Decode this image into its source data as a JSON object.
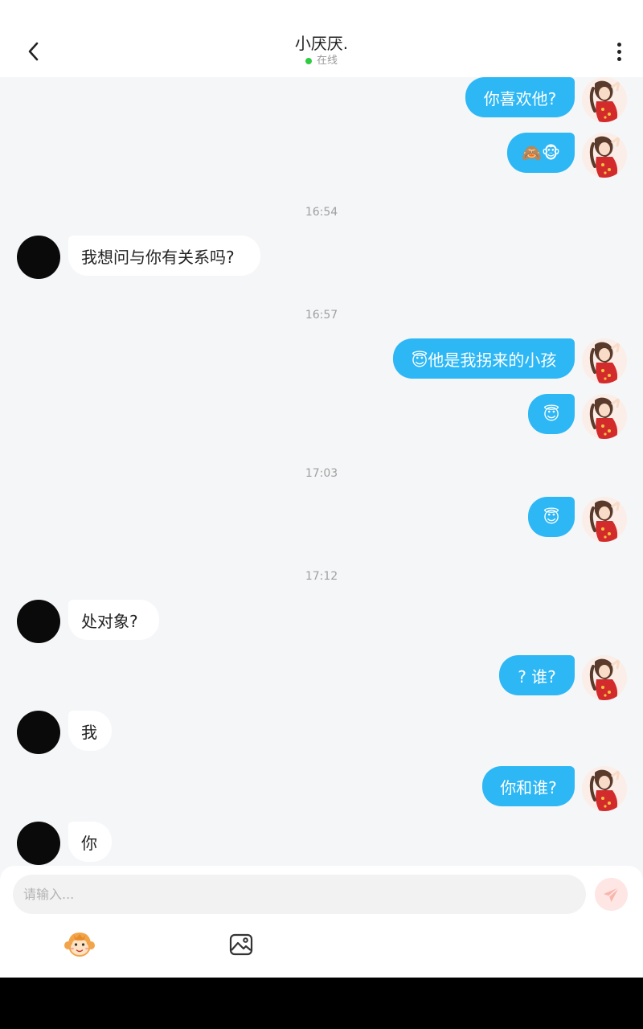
{
  "header": {
    "title": "小厌厌.",
    "status": "在线",
    "status_color": "#2ecc40"
  },
  "messages": [
    {
      "kind": "out",
      "text": "你喜欢他?"
    },
    {
      "kind": "out",
      "text": "🙈🐵"
    },
    {
      "kind": "time",
      "text": "16:54"
    },
    {
      "kind": "in",
      "text": "我想问与你有关系吗?"
    },
    {
      "kind": "time",
      "text": "16:57"
    },
    {
      "kind": "out",
      "text": "😇他是我拐来的小孩"
    },
    {
      "kind": "out",
      "text": "😇"
    },
    {
      "kind": "time",
      "text": "17:03"
    },
    {
      "kind": "out",
      "text": "😇"
    },
    {
      "kind": "time",
      "text": "17:12"
    },
    {
      "kind": "in",
      "text": "处对象?"
    },
    {
      "kind": "out",
      "text": "? 谁?"
    },
    {
      "kind": "in",
      "text": "我"
    },
    {
      "kind": "out",
      "text": "你和谁?"
    },
    {
      "kind": "in",
      "text": "你"
    }
  ],
  "input": {
    "placeholder": "请输入...",
    "value": ""
  },
  "toolbar": {
    "emoji_icon": "monkey-face-icon",
    "image_icon": "image-icon",
    "send_icon": "paper-plane-icon"
  },
  "colors": {
    "accent": "#2db7f5",
    "background": "#f5f6f8",
    "send_button_bg": "#fde6e3"
  }
}
